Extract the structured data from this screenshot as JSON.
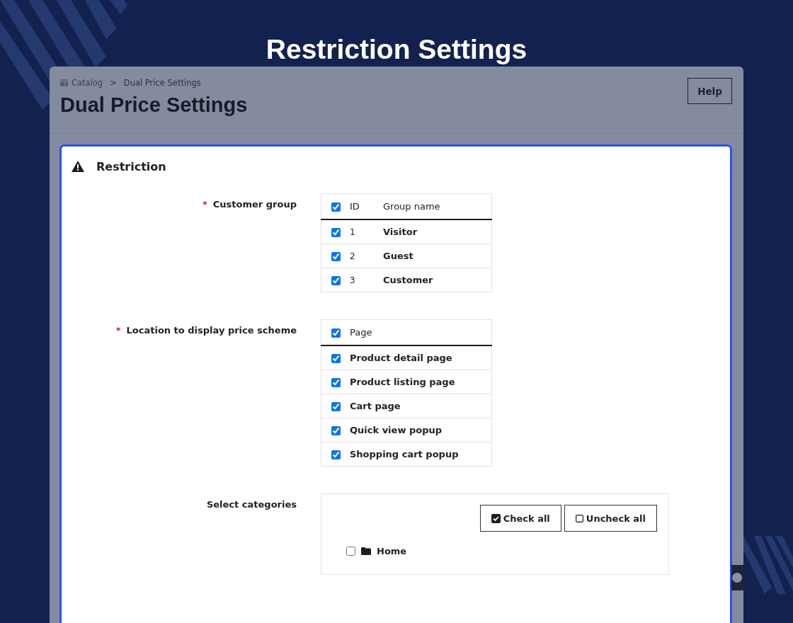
{
  "page_title": "Restriction Settings",
  "breadcrumb": {
    "items": [
      "Catalog",
      "Dual Price Settings"
    ],
    "separator": ">"
  },
  "heading": "Dual Price Settings",
  "help_button": "Help",
  "section": {
    "title": "Restriction"
  },
  "customer_group": {
    "label": "Customer group",
    "required_mark": "*",
    "header_checked": true,
    "columns": [
      "ID",
      "Group name"
    ],
    "rows": [
      {
        "id": "1",
        "name": "Visitor",
        "checked": true
      },
      {
        "id": "2",
        "name": "Guest",
        "checked": true
      },
      {
        "id": "3",
        "name": "Customer",
        "checked": true
      }
    ]
  },
  "location": {
    "label": "Location to display price scheme",
    "required_mark": "*",
    "header_checked": true,
    "columns": [
      "Page"
    ],
    "rows": [
      {
        "name": "Product detail page",
        "checked": true
      },
      {
        "name": "Product listing page",
        "checked": true
      },
      {
        "name": "Cart page",
        "checked": true
      },
      {
        "name": "Quick view popup",
        "checked": true
      },
      {
        "name": "Shopping cart popup",
        "checked": true
      }
    ]
  },
  "categories": {
    "label": "Select categories",
    "buttons": [
      {
        "label": "Check all",
        "kind": "check"
      },
      {
        "label": "Uncheck all",
        "kind": "uncheck"
      }
    ],
    "tree": [
      {
        "label": "Home",
        "checked": false
      }
    ]
  }
}
